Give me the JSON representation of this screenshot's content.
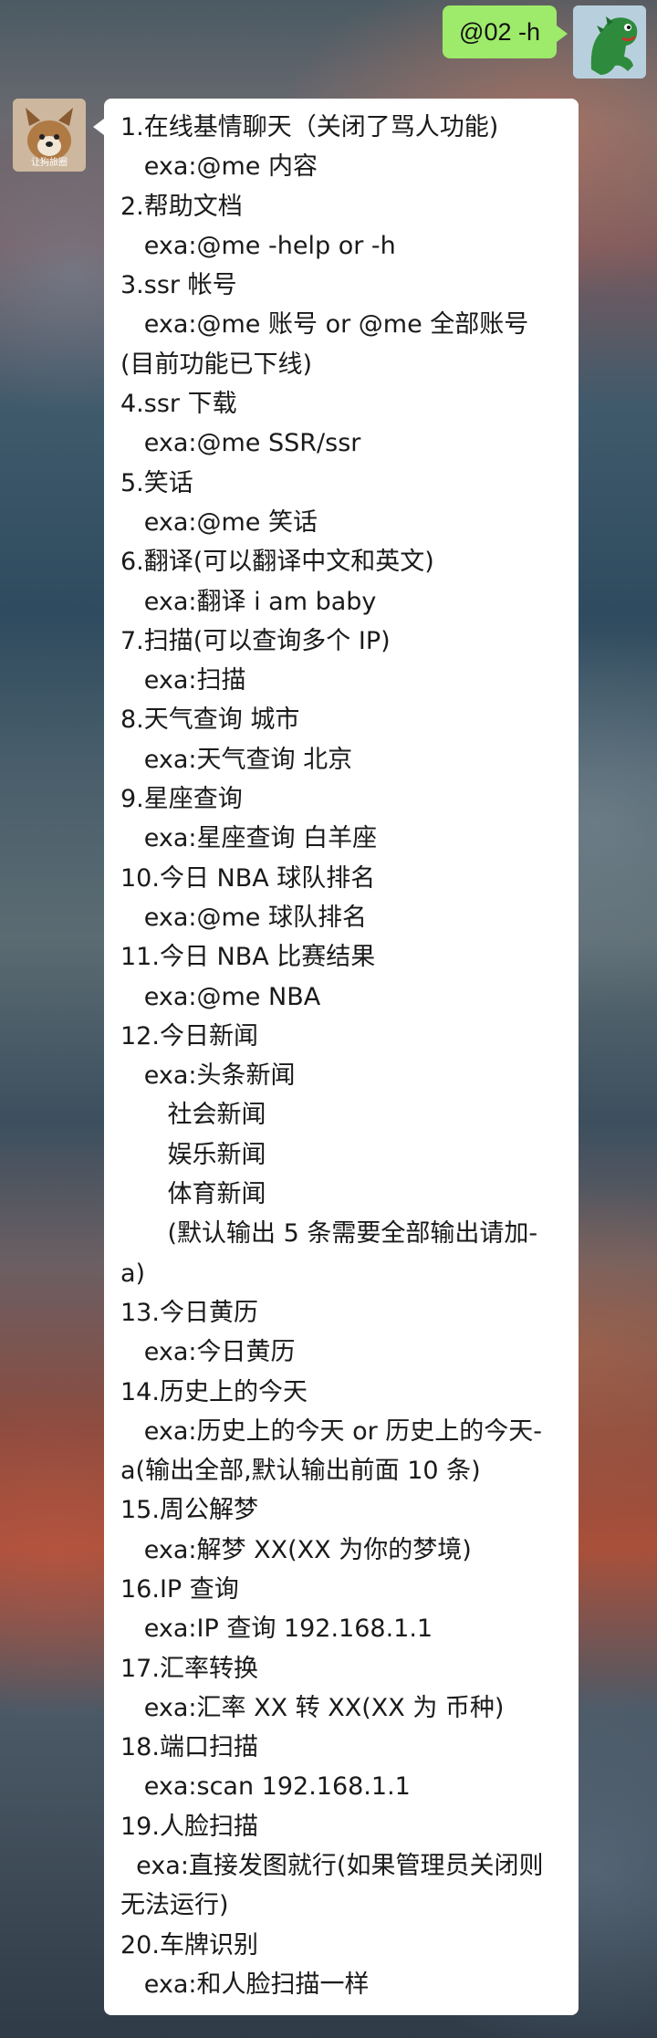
{
  "sent_message": {
    "text": "@02 -h"
  },
  "received_message": {
    "sender_avatar_caption": "让狗旅圈",
    "lines": [
      "1.在线基情聊天（关闭了骂人功能)",
      "   exa:@me 内容",
      "2.帮助文档",
      "   exa:@me -help or -h",
      "3.ssr 帐号",
      "   exa:@me 账号 or @me 全部账号",
      "(目前功能已下线)",
      "4.ssr 下载",
      "   exa:@me SSR/ssr",
      "5.笑话",
      "   exa:@me 笑话",
      "6.翻译(可以翻译中文和英文)",
      "   exa:翻译 i am baby",
      "7.扫描(可以查询多个 IP)",
      "   exa:扫描",
      "8.天气查询 城市",
      "   exa:天气查询 北京",
      "9.星座查询",
      "   exa:星座查询 白羊座",
      "10.今日 NBA 球队排名",
      "   exa:@me 球队排名",
      "11.今日 NBA 比赛结果",
      "   exa:@me NBA",
      "12.今日新闻",
      "   exa:头条新闻",
      "      社会新闻",
      "      娱乐新闻",
      "      体育新闻",
      "      (默认输出 5 条需要全部输出请加-",
      "a)",
      "13.今日黄历",
      "   exa:今日黄历",
      "14.历史上的今天",
      "   exa:历史上的今天 or 历史上的今天-",
      "a(输出全部,默认输出前面 10 条)",
      "15.周公解梦",
      "   exa:解梦 XX(XX 为你的梦境)",
      "16.IP 查询",
      "   exa:IP 查询 192.168.1.1",
      "17.汇率转换",
      "   exa:汇率 XX 转 XX(XX 为 币种)",
      "18.端口扫描",
      "   exa:scan 192.168.1.1",
      "19.人脸扫描",
      "  exa:直接发图就行(如果管理员关闭则",
      "无法运行)",
      "20.车牌识别",
      "   exa:和人脸扫描一样"
    ]
  },
  "colors": {
    "sent_bubble": "#9eea6a",
    "received_bubble": "#ffffff"
  }
}
